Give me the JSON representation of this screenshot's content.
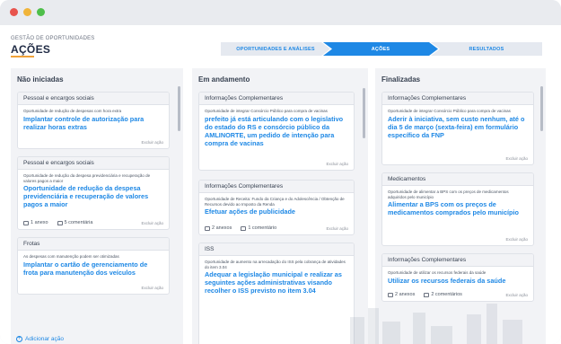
{
  "header": {
    "breadcrumb": "GESTÃO DE OPORTUNIDADES",
    "title": "AÇÕES"
  },
  "steps": [
    "OPORTUNIDADES E ANÁLISES",
    "AÇÕES",
    "RESULTADOS"
  ],
  "columns": [
    {
      "title": "Não iniciadas",
      "add_label": "Adicionar ação",
      "cards": [
        {
          "category": "Pessoal e encargos sociais",
          "desc": "Oportunidade de redução de despesas com hora extra",
          "title": "Implantar controle de autorização para realizar horas extras",
          "excl": "Excluir ação"
        },
        {
          "category": "Pessoal e encargos sociais",
          "desc": "Oportunidade de redução da despesa previdenciária e recuperação de valores pagos a maior",
          "title": "Oportunidade de redução da despesa previdenciária e recuperação de valores pagos a maior",
          "attachments": "1 anexo",
          "comments": "5 comentária",
          "excl": "Excluir ação"
        },
        {
          "category": "Frotas",
          "desc": "As despesas com manutenção podem ser otimizadas",
          "title": "Implantar o cartão de gerenciamento de frota para manutenção dos veículos",
          "excl": "Excluir ação"
        }
      ]
    },
    {
      "title": "Em andamento",
      "cards": [
        {
          "category": "Informações Complementares",
          "desc": "Oportunidade de integrar Consórcio Público para compra de vacinas",
          "title": "prefeito já está articulando com o legislativo do estado do RS e consórcio público da AMLINORTE, um pedido de intenção para compra de vacinas",
          "excl": "Excluir ação"
        },
        {
          "category": "Informações Complementares",
          "desc": "Oportunidade de Receita: Fundo da Criança e do Adolescência / Obtenção de Recursos devido ao Imposto da Renda",
          "title": "Efetuar ações de publicidade",
          "attachments": "2 anexos",
          "comments": "1 comentário",
          "excl": "Excluir ação"
        },
        {
          "category": "ISS",
          "desc": "Oportunidade de aumento na arrecadação do ISS pela cobrança de atividades do item 3.04",
          "title": "Adequar a legislação municipal e realizar as seguintes ações administrativas visando recolher o ISS previsto no item 3.04"
        }
      ]
    },
    {
      "title": "Finalizadas",
      "cards": [
        {
          "category": "Informações Complementares",
          "desc": "Oportunidade de integrar Consórcio Público para compra de vacinas",
          "title": "Aderir à iniciativa, sem custo nenhum, até o dia 5 de março (sexta-feira) em formulário específico da FNP",
          "excl": "Excluir ação"
        },
        {
          "category": "Medicamentos",
          "desc": "Oportunidade de alimentar a BPS com os preços de medicamentos adquiridos pelo município",
          "title": "Alimentar a BPS com os preços de medicamentos comprados pelo município",
          "excl": "Excluir ação"
        },
        {
          "category": "Informações Complementares",
          "desc": "Oportunidade de utilizar os recursos federais da saúde",
          "title": "Utilizar os recursos federais da saúde",
          "attachments": "2 anexos",
          "comments": "2 comentários",
          "excl": "Excluir ação"
        }
      ]
    }
  ],
  "colors": {
    "accent": "#1e88e5",
    "title_underline": "#f0a23a",
    "column_bg": "#f2f3f6"
  }
}
